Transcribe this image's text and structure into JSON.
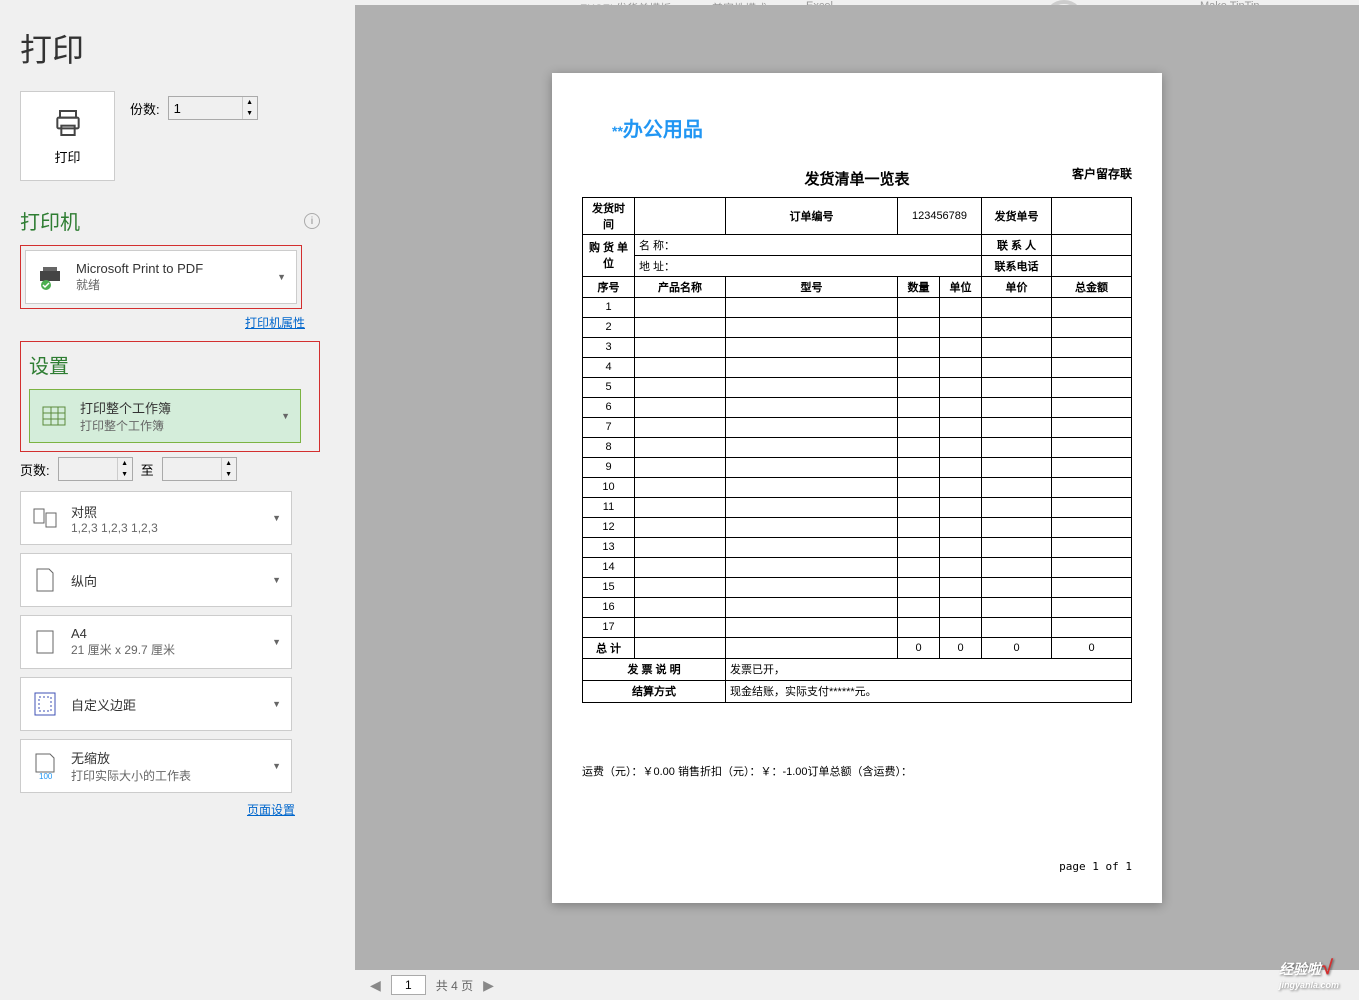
{
  "topBar": {
    "text1": "EXCEL发货单模板",
    "text2": "兼容性模式",
    "text3": "Excel",
    "text4": "Make TinTin"
  },
  "pageTitle": "打印",
  "printButton": "打印",
  "copies": {
    "label": "份数:",
    "value": "1"
  },
  "printerSection": {
    "title": "打印机",
    "name": "Microsoft Print to PDF",
    "status": "就绪",
    "propertiesLink": "打印机属性"
  },
  "settingsSection": {
    "title": "设置",
    "scope": {
      "line1": "打印整个工作簿",
      "line2": "打印整个工作簿"
    },
    "pages": {
      "label": "页数:",
      "toLabel": "至"
    },
    "collate": {
      "line1": "对照",
      "line2": "1,2,3    1,2,3    1,2,3"
    },
    "orientation": {
      "line1": "纵向"
    },
    "paper": {
      "line1": "A4",
      "line2": "21 厘米 x 29.7 厘米"
    },
    "margins": {
      "line1": "自定义边距"
    },
    "scaling": {
      "line1": "无缩放",
      "line2": "打印实际大小的工作表"
    },
    "pageSetupLink": "页面设置"
  },
  "preview": {
    "logo": "办公用品",
    "title": "发货清单一览表",
    "subtitle": "客户留存联",
    "headerRow1": {
      "c1": "发货时间",
      "c3": "订单编号",
      "c4": "123456789",
      "c5": "发货单号"
    },
    "headerRow2": {
      "c1": "购 货 单位",
      "c2": "名 称：",
      "c5": "联 系 人"
    },
    "headerRow3": {
      "c2": "地 址：",
      "c5": "联系电话"
    },
    "columns": [
      "序号",
      "产品名称",
      "型号",
      "数量",
      "单位",
      "单价",
      "总金额"
    ],
    "rowNumbers": [
      "1",
      "2",
      "3",
      "4",
      "5",
      "6",
      "7",
      "8",
      "9",
      "10",
      "11",
      "12",
      "13",
      "14",
      "15",
      "16",
      "17"
    ],
    "totalRow": {
      "label": "总 计",
      "qty": "0",
      "unit": "0",
      "price": "0",
      "amount": "0"
    },
    "invoiceRow": {
      "label": "发 票 说 明",
      "value": "发票已开，"
    },
    "paymentRow": {
      "label": "结算方式",
      "value": "现金结账，实际支付******元。"
    },
    "footerNote": "运费（元）：￥0.00    销售折扣（元）：￥：-1.00订单总额（含运费）：",
    "pageIndicator": "page 1 of 1"
  },
  "bottomNav": {
    "current": "1",
    "text": "共 4 页"
  },
  "watermark": {
    "main": "经验啦",
    "sub": "jingyanla.com"
  }
}
